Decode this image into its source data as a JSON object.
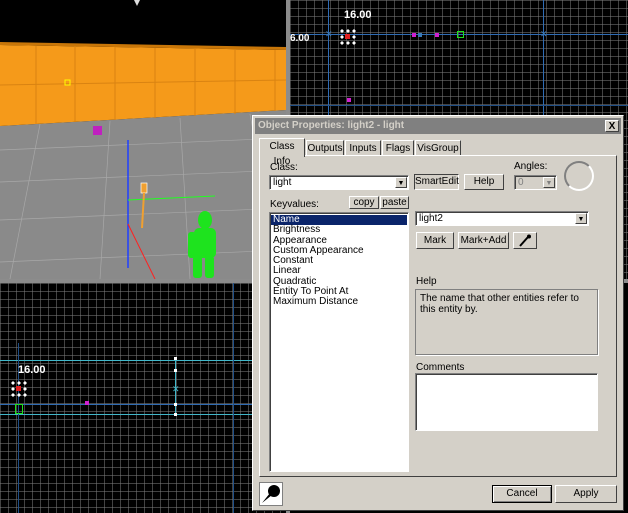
{
  "viewports": {
    "top_right": {
      "zoom_label": "16.00",
      "axis_label": "6.00"
    },
    "bottom_left": {
      "zoom_label": "16.00"
    }
  },
  "dialog": {
    "title": "Object Properties: light2 - light",
    "close_label": "X",
    "tabs": [
      "Class Info",
      "Outputs",
      "Inputs",
      "Flags",
      "VisGroup"
    ],
    "class_label": "Class:",
    "class_value": "light",
    "smartedit_label": "SmartEdit",
    "help_button": "Help",
    "angles_label": "Angles:",
    "angles_value": "0",
    "keyvalues_label": "Keyvalues:",
    "copy_button": "copy",
    "paste_button": "paste",
    "keyvalues": [
      "Name",
      "Brightness",
      "Appearance",
      "Custom Appearance",
      "Constant",
      "Linear",
      "Quadratic",
      "Entity To Point At",
      "Maximum Distance"
    ],
    "selected_keyvalue": "Name",
    "value_field": "light2",
    "mark_button": "Mark",
    "mark_add_button": "Mark+Add",
    "help_heading": "Help",
    "help_text": "The name that other entities refer to this entity by.",
    "comments_heading": "Comments",
    "comments_value": "",
    "cancel_button": "Cancel",
    "apply_button": "Apply"
  },
  "colors": {
    "wall_orange": "#f59a1a",
    "floor_gray": "#8a8a8a",
    "selection_blue": "#0a246a",
    "dialog_face": "#d4d0c8",
    "grid_cyan": "#41b7c9",
    "entity_green": "#1ee31e"
  }
}
